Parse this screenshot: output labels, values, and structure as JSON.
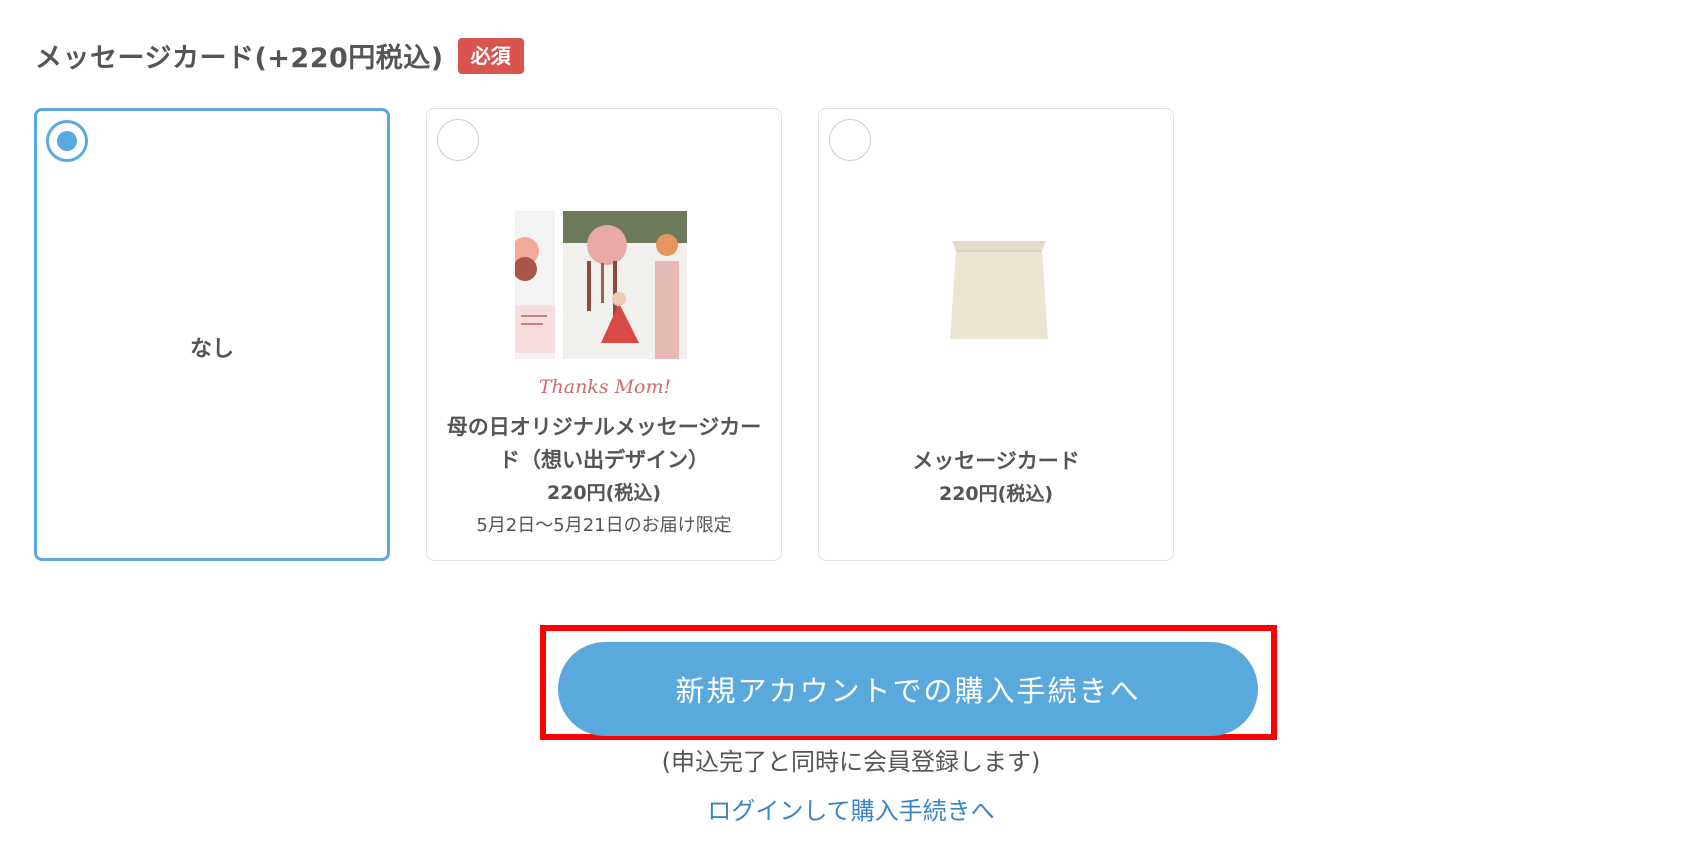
{
  "section": {
    "title": "メッセージカード(+220円税込)",
    "required_badge": "必須"
  },
  "options": [
    {
      "label": "なし",
      "selected": true
    },
    {
      "name_line1": "母の日オリジナルメッセージカー",
      "name_line2": "ド（想い出デザイン）",
      "price": "220円(税込)",
      "note": "5月2日〜5月21日のお届け限定",
      "image_text": "Thanks Mom!",
      "selected": false
    },
    {
      "name": "メッセージカード",
      "price": "220円(税込)",
      "selected": false
    }
  ],
  "cta": {
    "label": "新規アカウントでの購入手続きへ",
    "note": "(申込完了と同時に会員登録します)",
    "login_link": "ログインして購入手続きへ"
  },
  "colors": {
    "accent": "#5aa9dd",
    "badge": "#d9534f",
    "highlight_frame": "#ff0000",
    "link": "#3a86c4"
  }
}
